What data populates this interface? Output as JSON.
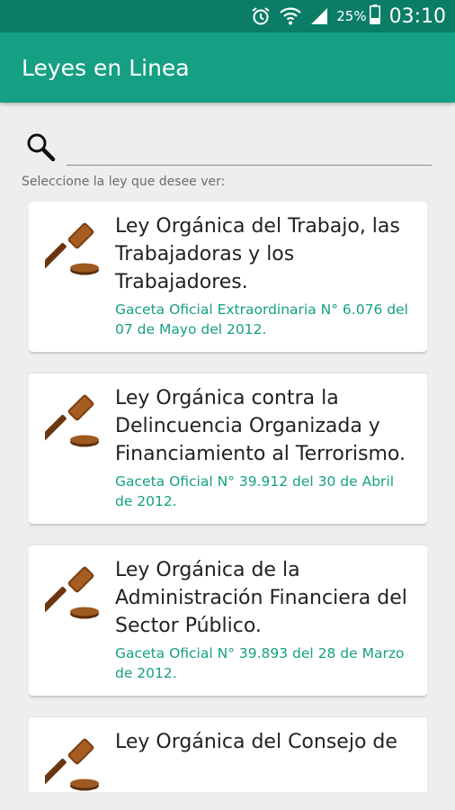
{
  "status_bar": {
    "battery_percent": "25%",
    "time": "03:10",
    "icons": [
      "alarm-icon",
      "wifi-icon",
      "signal-icon",
      "battery-icon"
    ]
  },
  "app_bar": {
    "title": "Leyes en Linea"
  },
  "search": {
    "value": "",
    "placeholder": ""
  },
  "instruction": "Seleccione la ley que desee ver:",
  "laws": [
    {
      "title": "Ley Orgánica del Trabajo, las Trabajadoras y los Trabajadores.",
      "gazette": "Gaceta  Oficial Extraordinaria N° 6.076 del 07 de Mayo del 2012."
    },
    {
      "title": "Ley Orgánica contra la Delincuencia Organizada y Financiamiento al Terrorismo.",
      "gazette": "Gaceta  Oficial N° 39.912 del 30 de Abril de 2012."
    },
    {
      "title": "Ley Orgánica de la Administración Financiera del Sector Público.",
      "gazette": "Gaceta  Oficial N° 39.893 del 28 de Marzo de 2012."
    },
    {
      "title": "Ley Orgánica del Consejo de",
      "gazette": ""
    }
  ],
  "colors": {
    "status_bar": "#0b7d66",
    "app_bar": "#16a083",
    "accent": "#16a083"
  }
}
